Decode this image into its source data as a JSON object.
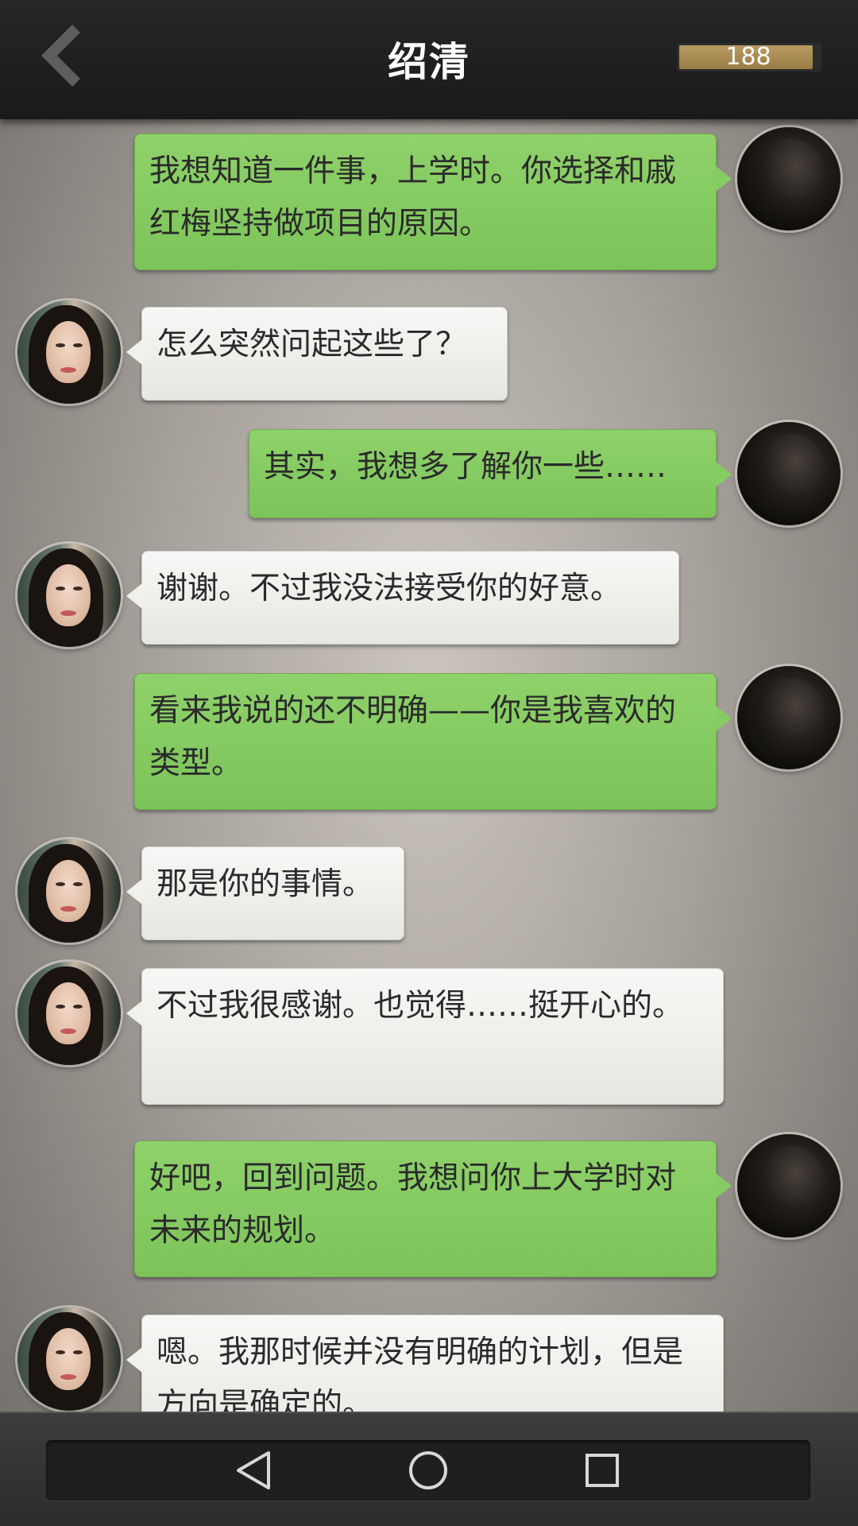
{
  "header": {
    "title": "绍清",
    "coin_value": "188"
  },
  "messages": [
    {
      "side": "self",
      "text": "我想知道一件事，上学时。你选择和戚红梅坚持做项目的原因。"
    },
    {
      "side": "her",
      "text": "怎么突然问起这些了？"
    },
    {
      "side": "self",
      "text": "其实，我想多了解你一些……"
    },
    {
      "side": "her",
      "text": "谢谢。不过我没法接受你的好意。"
    },
    {
      "side": "self",
      "text": "看来我说的还不明确——你是我喜欢的类型。"
    },
    {
      "side": "her",
      "text": "那是你的事情。"
    },
    {
      "side": "her",
      "text": "不过我很感谢。也觉得……挺开心的。"
    },
    {
      "side": "self",
      "text": "好吧，回到问题。我想问你上大学时对未来的规划。"
    },
    {
      "side": "her",
      "text": "嗯。我那时候并没有明确的计划，但是方向是确定的。"
    }
  ],
  "navbar": {
    "back_icon": "triangle-back-icon",
    "home_icon": "circle-home-icon",
    "recents_icon": "square-recents-icon"
  },
  "colors": {
    "self_bubble": "#86cc62",
    "her_bubble": "#f0f0ed",
    "header": "#1f1f1f",
    "coin_bar": "#a88a52"
  }
}
